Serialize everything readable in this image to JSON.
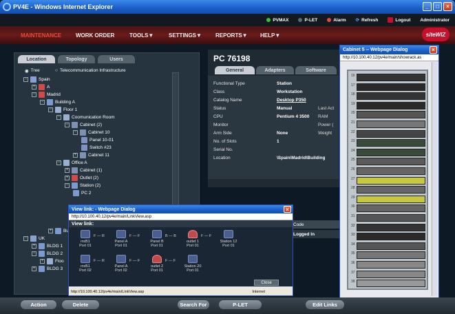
{
  "window": {
    "title": "PV4E - Windows Internet Explorer"
  },
  "topbar": {
    "pvmax": "PVMAX",
    "plet": "P-LET",
    "alarm": "Alarm",
    "refresh": "Refresh",
    "logout": "Logout",
    "user": "Administrator"
  },
  "nav": {
    "maintenance": "MAINTENANCE",
    "work_order": "WORK ORDER",
    "tools": "TOOLS▼",
    "settings": "SETTINGS▼",
    "reports": "REPORTS▼",
    "help": "HELP▼",
    "logo": "siteWIZ"
  },
  "left_tabs": [
    "Location",
    "Topology",
    "Users"
  ],
  "tree": {
    "radio_tree": "Tree",
    "radio_infra": "Telecommunication Infrastructure",
    "items": [
      {
        "label": "Spain",
        "toggle": "⊟"
      },
      {
        "label": "A",
        "toggle": "⊞"
      },
      {
        "label": "Madrid",
        "toggle": "⊟"
      },
      {
        "label": "Building A",
        "toggle": "⊟"
      },
      {
        "label": "Floor 1",
        "toggle": "⊟"
      },
      {
        "label": "Coomunication Room",
        "toggle": "⊟"
      },
      {
        "label": "Cabinet (2)",
        "toggle": "⊟"
      },
      {
        "label": "Cabinet 10",
        "toggle": "⊟"
      },
      {
        "label": "Panel 10-01",
        "toggle": ""
      },
      {
        "label": "Switch #23",
        "toggle": ""
      },
      {
        "label": "Cabinet 11",
        "toggle": "⊞"
      },
      {
        "label": "Office A",
        "toggle": "⊟"
      },
      {
        "label": "Cabinet (1)",
        "toggle": "⊞"
      },
      {
        "label": "Outlet (2)",
        "toggle": "⊞"
      },
      {
        "label": "Station (2)",
        "toggle": "⊟"
      },
      {
        "label": "PC 2",
        "toggle": ""
      },
      {
        "label": "Buil",
        "toggle": "⊞"
      },
      {
        "label": "UK",
        "toggle": "⊟"
      },
      {
        "label": "BLDG 1",
        "toggle": "⊞"
      },
      {
        "label": "BLDG 2",
        "toggle": "⊟"
      },
      {
        "label": "Floo",
        "toggle": "⊞"
      },
      {
        "label": "BLDG 3",
        "toggle": "⊞"
      }
    ]
  },
  "details": {
    "title": "PC 76198",
    "tabs": [
      "General",
      "Adapters",
      "Software"
    ],
    "rows": [
      {
        "k": "Functional Type",
        "v": "Station",
        "x": ""
      },
      {
        "k": "Class",
        "v": "Workstation",
        "x": ""
      },
      {
        "k": "Catalog Name",
        "v": "Desktop P350",
        "x": ""
      },
      {
        "k": "Status",
        "v": "Manual",
        "x": "Last Act"
      },
      {
        "k": "CPU",
        "v": "Pentium 4 3500",
        "x": "RAM"
      },
      {
        "k": "Monitor",
        "v": "",
        "x": "Power ("
      },
      {
        "k": "Arm Side",
        "v": "None",
        "x": "Weight"
      },
      {
        "k": "No. of Slots",
        "v": "1",
        "x": ""
      },
      {
        "k": "Serial No.",
        "v": "",
        "x": ""
      },
      {
        "k": "Location",
        "v": "\\Spain\\Madrid\\Building",
        "x": ""
      }
    ],
    "code_label": "Code",
    "logged_in": "Logged In"
  },
  "link_dialog": {
    "title": "View link: - Webpage Dialog",
    "address": "http://10.100.40.12/pv4e/main/LinkView.asp",
    "header": "View link:",
    "row1": [
      {
        "name": "md51",
        "port": "Port 01"
      },
      {
        "name": "Panel A",
        "port": "Port 01"
      },
      {
        "name": "Panel B",
        "port": "Port 01"
      },
      {
        "name": "outlet 1",
        "port": "Port 01"
      },
      {
        "name": "Station 12",
        "port": "Port 01"
      }
    ],
    "row1_conns": [
      "F — R",
      "F — F",
      "B — B",
      "F — F"
    ],
    "row2": [
      {
        "name": "md51",
        "port": "Port 02"
      },
      {
        "name": "Panel A",
        "port": "Port 02"
      },
      {
        "name": "outlet 2",
        "port": "Port 01"
      },
      {
        "name": "Station 20",
        "port": "Port 01"
      }
    ],
    "row2_conns": [
      "F — R",
      "F — F",
      "F — F"
    ],
    "close": "Close",
    "status_url": "http://10.100.40.12/pv4e/main/LinkView.asp",
    "status_zone": "Internet"
  },
  "cabinet_dialog": {
    "title": "Cabinet 5 -- Webpage Dialog",
    "address": "http://10.100.40.12/pv4e/main/showrack.as",
    "units": [
      "16",
      "17",
      "18",
      "19",
      "20",
      "21",
      "22",
      "23",
      "24",
      "25",
      "26",
      "27",
      "28",
      "29",
      "30",
      "31",
      "32",
      "33",
      "34",
      "35",
      "36",
      "37",
      "38"
    ]
  },
  "bottom": {
    "action": "Action",
    "delete": "Delete",
    "search": "Search For",
    "plet": "P-LET",
    "edit_links": "Edit Links"
  },
  "colors": {
    "alarm": "#e84a3a",
    "pvmax": "#3cc03c",
    "accent": "#c8102e"
  }
}
